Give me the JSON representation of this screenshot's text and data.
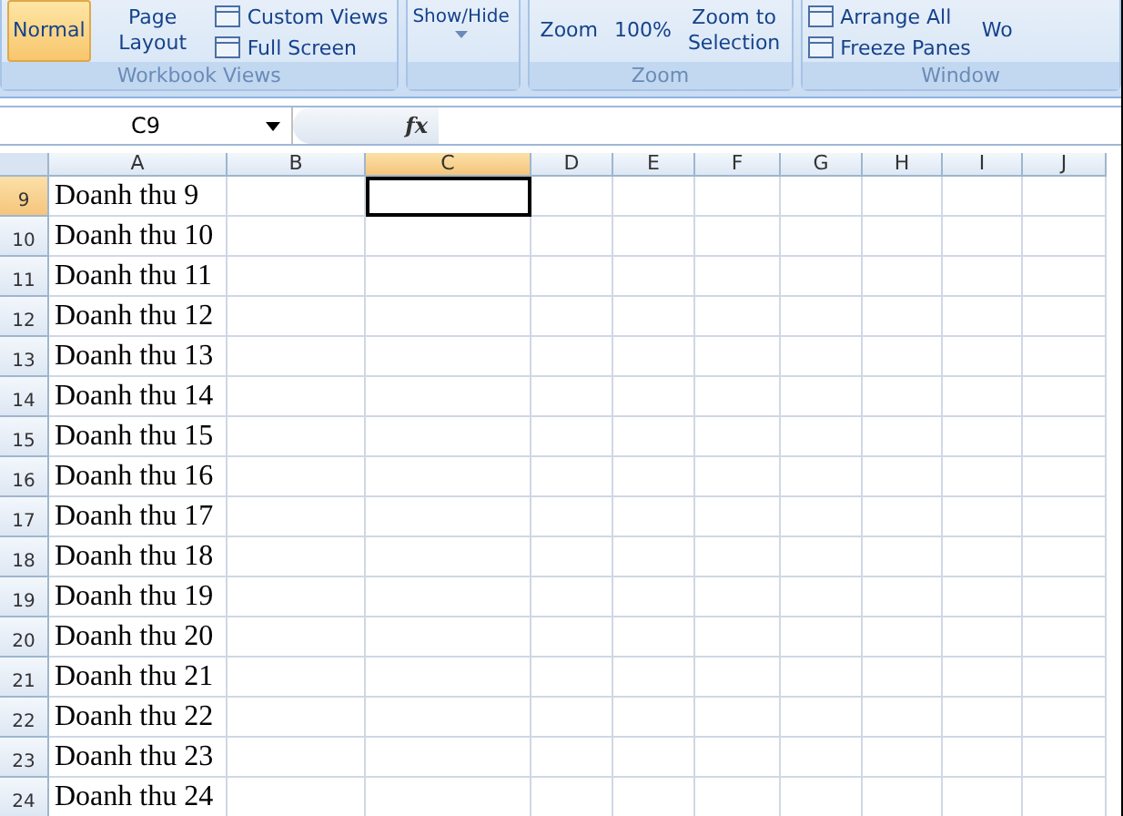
{
  "ribbon": {
    "groups": [
      {
        "label": "Workbook Views",
        "items": [
          {
            "kind": "big",
            "label": "Normal",
            "selected": true
          },
          {
            "kind": "big",
            "label": "Page Layout",
            "selected": false
          },
          {
            "kind": "stack",
            "entries": [
              "Custom Views",
              "Full Screen"
            ]
          }
        ]
      },
      {
        "items": [
          {
            "kind": "dropdown",
            "label": "Show/Hide"
          }
        ]
      },
      {
        "label": "Zoom",
        "items": [
          {
            "kind": "big",
            "label": "Zoom",
            "selected": false
          },
          {
            "kind": "big",
            "label": "100%",
            "selected": false
          },
          {
            "kind": "big",
            "label": "Zoom to Selection",
            "selected": false
          }
        ]
      },
      {
        "label": "Window",
        "items": [
          {
            "kind": "stack",
            "entries": [
              "Arrange All",
              "Freeze Panes"
            ]
          },
          {
            "kind": "big",
            "label": "Wo",
            "selected": false
          }
        ]
      }
    ]
  },
  "formula_bar": {
    "name_box": "C9",
    "fx": "fx"
  },
  "sheet": {
    "columns": [
      {
        "label": "A",
        "selected": false
      },
      {
        "label": "B",
        "selected": false
      },
      {
        "label": "C",
        "selected": true
      },
      {
        "label": "D",
        "selected": false
      },
      {
        "label": "E",
        "selected": false
      },
      {
        "label": "F",
        "selected": false
      },
      {
        "label": "G",
        "selected": false
      },
      {
        "label": "H",
        "selected": false
      },
      {
        "label": "I",
        "selected": false
      },
      {
        "label": "J",
        "selected": false
      }
    ],
    "rows": [
      {
        "number": "9",
        "selected": true,
        "cells": [
          "Doanh thu 9"
        ]
      },
      {
        "number": "10",
        "selected": false,
        "cells": [
          "Doanh thu 10"
        ]
      },
      {
        "number": "11",
        "selected": false,
        "cells": [
          "Doanh thu 11"
        ]
      },
      {
        "number": "12",
        "selected": false,
        "cells": [
          "Doanh thu 12"
        ]
      },
      {
        "number": "13",
        "selected": false,
        "cells": [
          "Doanh thu 13"
        ]
      },
      {
        "number": "14",
        "selected": false,
        "cells": [
          "Doanh thu 14"
        ]
      },
      {
        "number": "15",
        "selected": false,
        "cells": [
          "Doanh thu 15"
        ]
      },
      {
        "number": "16",
        "selected": false,
        "cells": [
          "Doanh thu 16"
        ]
      },
      {
        "number": "17",
        "selected": false,
        "cells": [
          "Doanh thu 17"
        ]
      },
      {
        "number": "18",
        "selected": false,
        "cells": [
          "Doanh thu 18"
        ]
      },
      {
        "number": "19",
        "selected": false,
        "cells": [
          "Doanh thu 19"
        ]
      },
      {
        "number": "20",
        "selected": false,
        "cells": [
          "Doanh thu 20"
        ]
      },
      {
        "number": "21",
        "selected": false,
        "cells": [
          "Doanh thu 21"
        ]
      },
      {
        "number": "22",
        "selected": false,
        "cells": [
          "Doanh thu 22"
        ]
      },
      {
        "number": "23",
        "selected": false,
        "cells": [
          "Doanh thu 23"
        ]
      },
      {
        "number": "24",
        "selected": false,
        "cells": [
          "Doanh thu 24"
        ]
      }
    ]
  }
}
